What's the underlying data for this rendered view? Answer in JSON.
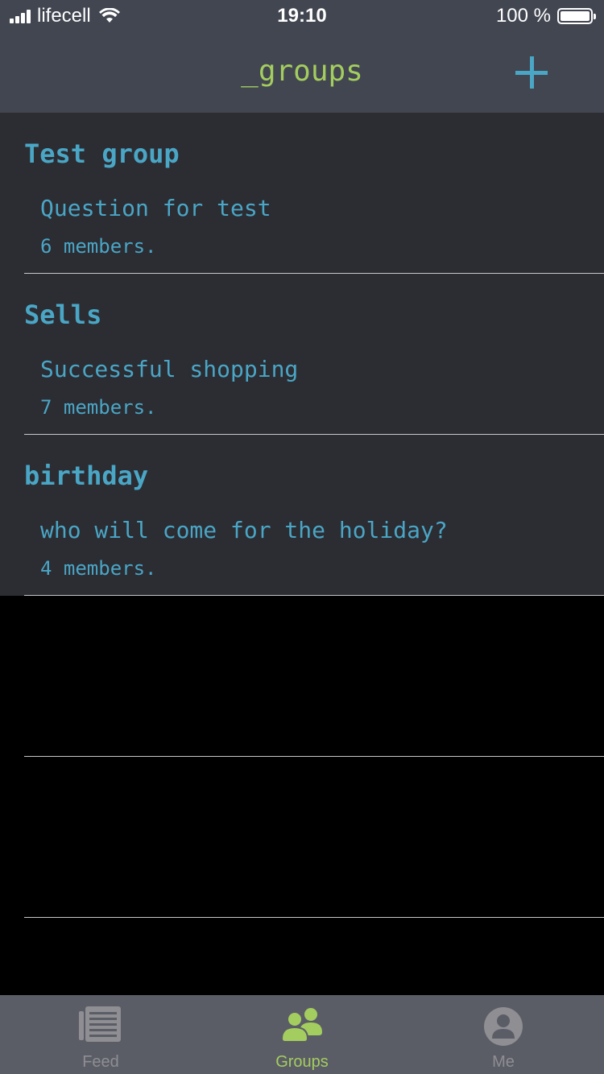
{
  "status_bar": {
    "carrier": "lifecell",
    "time": "19:10",
    "battery_percent": "100 %"
  },
  "header": {
    "title": "_groups",
    "add_icon": "plus-icon"
  },
  "groups": [
    {
      "name": "Test group",
      "question": "Question for test",
      "members": "6 members."
    },
    {
      "name": "Sells",
      "question": "Successful shopping",
      "members": "7 members."
    },
    {
      "name": "birthday",
      "question": "who will come for the holiday?",
      "members": "4 members."
    }
  ],
  "tab_bar": {
    "tabs": [
      {
        "label": "Feed",
        "icon": "newspaper-icon",
        "selected": false
      },
      {
        "label": "Groups",
        "icon": "people-icon",
        "selected": true
      },
      {
        "label": "Me",
        "icon": "person-circle-icon",
        "selected": false
      }
    ]
  },
  "colors": {
    "bar_background": "#424651",
    "row_background": "#2c2c33",
    "accent_blue": "#4aa6c5",
    "accent_green": "#a4cd5f",
    "tab_bar_background": "#5b5d66",
    "tab_inactive": "#8e8e93"
  }
}
